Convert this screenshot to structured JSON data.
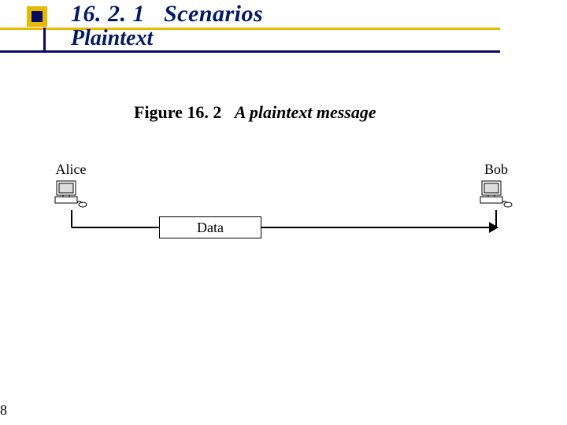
{
  "header": {
    "section_number": "16. 2. 1",
    "section_title": "Scenarios",
    "sub_title": "Plaintext"
  },
  "figure": {
    "prefix": "Figure 16. 2",
    "title": "A plaintext message"
  },
  "diagram": {
    "sender_label": "Alice",
    "receiver_label": "Bob",
    "payload_label": "Data"
  },
  "page_number": "8",
  "colors": {
    "accent_yellow": "#e7b900",
    "accent_blue": "#070b63",
    "text_blue": "#011a63"
  }
}
